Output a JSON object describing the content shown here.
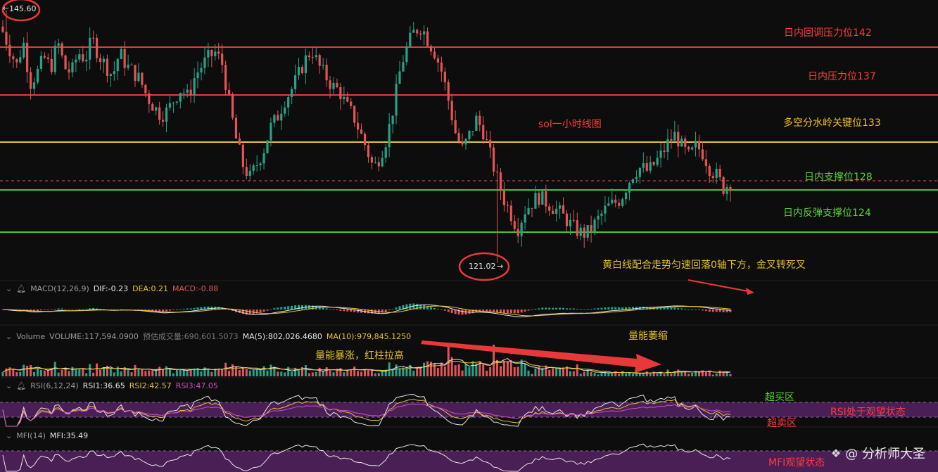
{
  "colors": {
    "up": "#27a38a",
    "down": "#e25455",
    "red_line": "#e8393a",
    "yellow_line": "#e5c23a",
    "green_line": "#4fbf2f",
    "purple_band": "#4a1f55"
  },
  "annotations": {
    "top_price": "145.60",
    "low_price": "121.02",
    "level_142": "日内回调压力位142",
    "level_137": "日内压力位137",
    "level_133": "多空分水岭关键位133",
    "level_128": "日内支撑位128",
    "level_124": "日内反弹支撑位124",
    "chart_title": "sol一小时线图",
    "macd_note": "黄白线配合走势匀速回落0轴下方，金叉转死叉",
    "volume_shrink": "量能萎缩",
    "volume_surge": "量能暴涨，红柱拉高",
    "overbought": "超买区",
    "oversold": "超卖区",
    "rsi_note": "RSI处于观望状态",
    "mfi_note": "MFI观望状态"
  },
  "macd": {
    "label": "MACD(12,26,9)",
    "dif": "DIF:-0.23",
    "dea": "DEA:0.21",
    "macd": "MACD:-0.88"
  },
  "volume": {
    "label": "Volume",
    "volume": "VOLUME:117,594.0900",
    "est": "预估成交量:690,601.5073",
    "ma5": "MA(5):802,026.4680",
    "ma10": "MA(10):979,845.1250"
  },
  "rsi": {
    "label": "RSI(6,12,24)",
    "rsi1": "RSI1:36.65",
    "rsi2": "RSI2:42.57",
    "rsi3": "RSI3:47.05"
  },
  "mfi": {
    "label": "MFI(14)",
    "mfi": "MFI:35.49"
  },
  "watermark": {
    "icon": "binance-square-icon",
    "text": "@ 分析师大圣"
  },
  "chart_data": {
    "type": "candlestick",
    "title": "sol一小时线图",
    "ylim": [
      119,
      147
    ],
    "levels": [
      142,
      137,
      133,
      128,
      124
    ],
    "high": 145.6,
    "low": 121.02,
    "last": 128.8,
    "path": [
      143.5,
      141.8,
      140.2,
      142.5,
      138.5,
      139.5,
      141,
      140,
      142.5,
      140,
      139.5,
      141.5,
      140.8,
      142.8,
      141.2,
      140.2,
      139.2,
      141.5,
      140.2,
      139.6,
      138.8,
      137.2,
      136.2,
      135.4,
      135.8,
      137,
      138,
      137.1,
      139.2,
      140.2,
      141,
      141.5,
      140.3,
      136.5,
      133,
      130.5,
      129.3,
      130.6,
      132,
      134.2,
      135.2,
      136.8,
      137.8,
      139.2,
      140.7,
      141.8,
      140.2,
      139.2,
      138.2,
      137.8,
      136.3,
      135.4,
      133.8,
      132.1,
      130.2,
      131.5,
      133.3,
      136.5,
      140.2,
      142.2,
      143.6,
      144,
      142.6,
      141.4,
      139.5,
      136.6,
      133.5,
      132,
      133.5,
      135,
      133.8,
      131.5,
      129.2,
      127.2,
      125.8,
      124.3,
      126.1,
      126.8,
      127.5,
      127,
      126.5,
      126,
      125.3,
      124.5,
      124,
      123.8,
      124.6,
      125.5,
      126.4,
      126.8,
      127.2,
      128.7,
      129.9,
      130.3,
      129.9,
      130.7,
      131.6,
      132.8,
      133.5,
      132.2,
      131.3,
      132.4,
      131.7,
      130.2,
      129.5,
      128.3,
      128.8
    ]
  }
}
